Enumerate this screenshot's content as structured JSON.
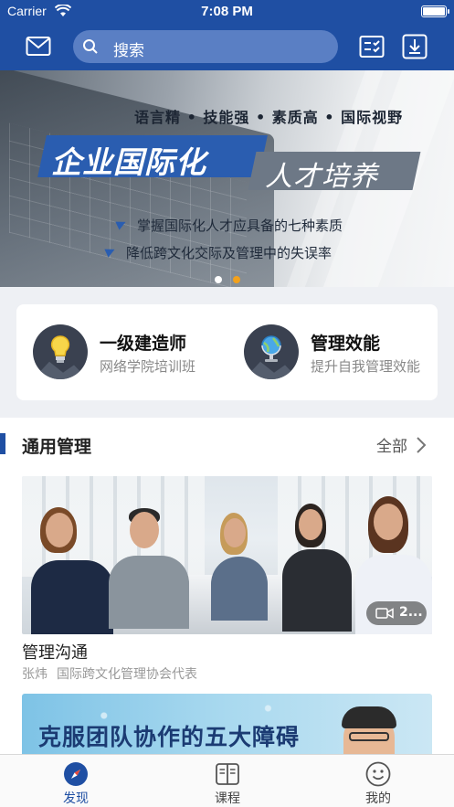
{
  "status_bar": {
    "carrier": "Carrier",
    "time": "7:08 PM"
  },
  "header": {
    "search_placeholder": "搜索"
  },
  "banner": {
    "tagline": "语言精 • 技能强 • 素质高 • 国际视野",
    "title": "企业国际化",
    "subtitle": "人才培养",
    "bullet_1": "掌握国际化人才应具备的七种素质",
    "bullet_2": "降低跨文化交际及管理中的失误率",
    "page_count": 2,
    "active_page": 2
  },
  "featured": [
    {
      "title": "一级建造师",
      "subtitle": "网络学院培训班",
      "icon": "lightbulb-icon"
    },
    {
      "title": "管理效能",
      "subtitle": "提升自我管理效能",
      "icon": "globe-icon"
    }
  ],
  "section": {
    "title": "通用管理",
    "more": "全部"
  },
  "courses": [
    {
      "title": "管理沟通",
      "teacher": "张炜",
      "org": "国际跨文化管理协会代表",
      "badge": "2..."
    },
    {
      "thumb_text": "克服团队协作的五大障碍"
    }
  ],
  "tabs": [
    {
      "label": "发现",
      "icon": "compass-icon",
      "active": true
    },
    {
      "label": "课程",
      "icon": "book-icon",
      "active": false
    },
    {
      "label": "我的",
      "icon": "smiley-icon",
      "active": false
    }
  ],
  "colors": {
    "brand_blue": "#1f4fa3",
    "accent_orange": "#f2a11c"
  }
}
